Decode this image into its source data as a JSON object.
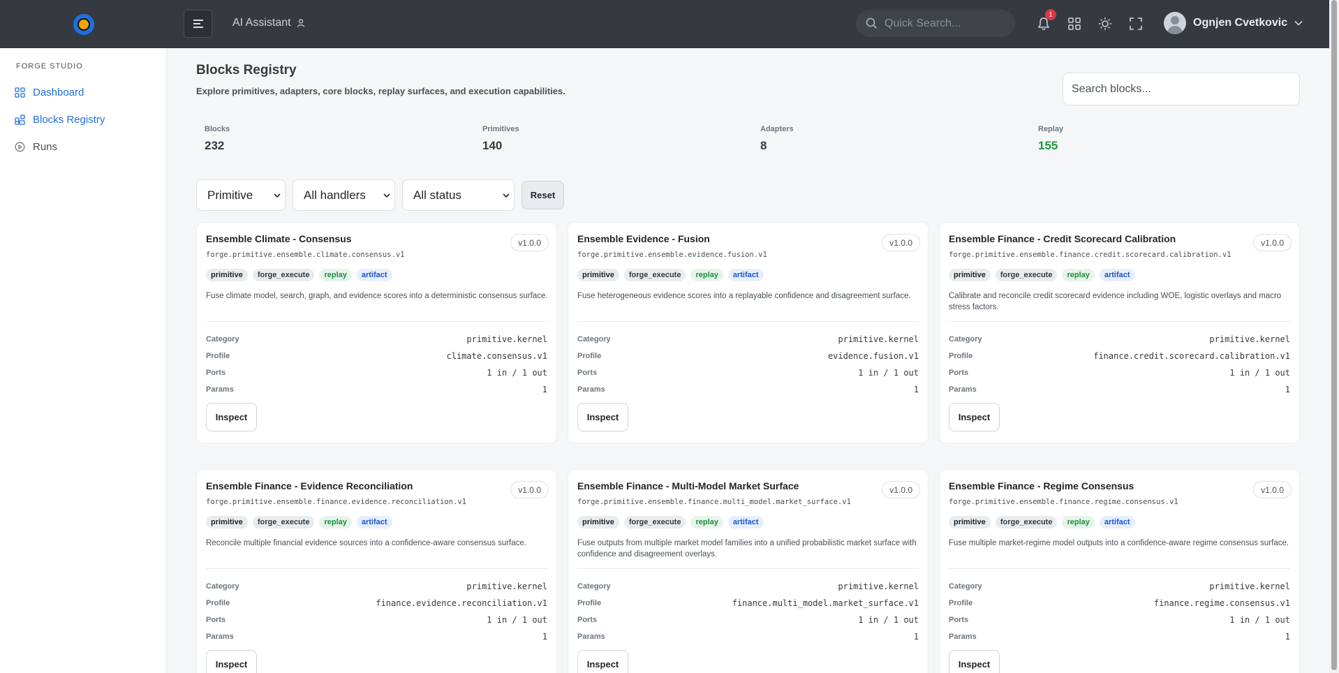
{
  "topbar": {
    "ai_assistant": "AI Assistant",
    "quick_search_placeholder": "Quick Search...",
    "notification_count": "1",
    "user_name": "Ognjen Cvetkovic"
  },
  "sidebar": {
    "section_title": "FORGE STUDIO",
    "items": [
      {
        "label": "Dashboard",
        "icon": "grid-icon"
      },
      {
        "label": "Blocks Registry",
        "icon": "blocks-icon"
      },
      {
        "label": "Runs",
        "icon": "play-circle-icon"
      }
    ]
  },
  "page": {
    "title": "Blocks Registry",
    "subtitle": "Explore primitives, adapters, core blocks, replay surfaces, and execution capabilities.",
    "search_placeholder": "Search blocks..."
  },
  "stats": [
    {
      "label": "Blocks",
      "value": "232"
    },
    {
      "label": "Primitives",
      "value": "140"
    },
    {
      "label": "Adapters",
      "value": "8"
    },
    {
      "label": "Replay",
      "value": "155"
    }
  ],
  "filters": {
    "type": "Primitive",
    "handler": "All handlers",
    "status": "All status",
    "reset": "Reset"
  },
  "field_labels": {
    "category": "Category",
    "profile": "Profile",
    "ports": "Ports",
    "params": "Params",
    "inspect": "Inspect"
  },
  "cards": [
    {
      "title": "Ensemble Climate - Consensus",
      "version": "v1.0.0",
      "id": "forge.primitive.ensemble.climate.consensus.v1",
      "tags": [
        "primitive",
        "forge_execute",
        "replay",
        "artifact"
      ],
      "description": "Fuse climate model, search, graph, and evidence scores into a deterministic consensus surface.",
      "category": "primitive.kernel",
      "profile": "climate.consensus.v1",
      "ports": "1 in / 1 out",
      "params": "1"
    },
    {
      "title": "Ensemble Evidence - Fusion",
      "version": "v1.0.0",
      "id": "forge.primitive.ensemble.evidence.fusion.v1",
      "tags": [
        "primitive",
        "forge_execute",
        "replay",
        "artifact"
      ],
      "description": "Fuse heterogeneous evidence scores into a replayable confidence and disagreement surface.",
      "category": "primitive.kernel",
      "profile": "evidence.fusion.v1",
      "ports": "1 in / 1 out",
      "params": "1"
    },
    {
      "title": "Ensemble Finance - Credit Scorecard Calibration",
      "version": "v1.0.0",
      "id": "forge.primitive.ensemble.finance.credit.scorecard.calibration.v1",
      "tags": [
        "primitive",
        "forge_execute",
        "replay",
        "artifact"
      ],
      "description": "Calibrate and reconcile credit scorecard evidence including WOE, logistic overlays and macro stress factors.",
      "category": "primitive.kernel",
      "profile": "finance.credit.scorecard.calibration.v1",
      "ports": "1 in / 1 out",
      "params": "1"
    },
    {
      "title": "Ensemble Finance - Evidence Reconciliation",
      "version": "v1.0.0",
      "id": "forge.primitive.ensemble.finance.evidence.reconciliation.v1",
      "tags": [
        "primitive",
        "forge_execute",
        "replay",
        "artifact"
      ],
      "description": "Reconcile multiple financial evidence sources into a confidence-aware consensus surface.",
      "category": "primitive.kernel",
      "profile": "finance.evidence.reconciliation.v1",
      "ports": "1 in / 1 out",
      "params": "1"
    },
    {
      "title": "Ensemble Finance - Multi-Model Market Surface",
      "version": "v1.0.0",
      "id": "forge.primitive.ensemble.finance.multi_model.market_surface.v1",
      "tags": [
        "primitive",
        "forge_execute",
        "replay",
        "artifact"
      ],
      "description": "Fuse outputs from multiple market model families into a unified probabilistic market surface with confidence and disagreement overlays.",
      "category": "primitive.kernel",
      "profile": "finance.multi_model.market_surface.v1",
      "ports": "1 in / 1 out",
      "params": "1"
    },
    {
      "title": "Ensemble Finance - Regime Consensus",
      "version": "v1.0.0",
      "id": "forge.primitive.ensemble.finance.regime.consensus.v1",
      "tags": [
        "primitive",
        "forge_execute",
        "replay",
        "artifact"
      ],
      "description": "Fuse multiple market-regime model outputs into a confidence-aware regime consensus surface.",
      "category": "primitive.kernel",
      "profile": "finance.regime.consensus.v1",
      "ports": "1 in / 1 out",
      "params": "1"
    }
  ]
}
